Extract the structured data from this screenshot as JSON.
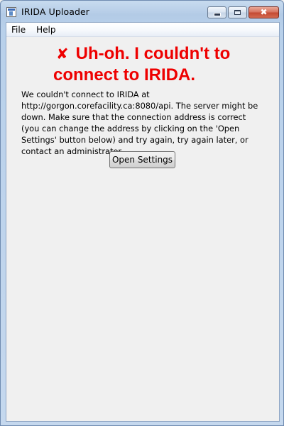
{
  "window": {
    "title": "IRIDA Uploader",
    "icon": "application-icon",
    "controls": {
      "minimize": "minimize-icon",
      "maximize": "maximize-icon",
      "close": "close-icon",
      "close_glyph": "✖"
    }
  },
  "menu": {
    "file": "File",
    "help": "Help"
  },
  "error": {
    "icon": "✘",
    "title": "Uh-oh. I couldn't to connect to IRIDA.",
    "message": "We couldn't connect to IRIDA at http://gorgon.corefacility.ca:8080/api. The server might be down. Make sure that the connection address is correct (you can change the address by clicking on the 'Open Settings' button below) and try again, try again later, or contact an administrator."
  },
  "actions": {
    "open_settings": "Open Settings"
  },
  "colors": {
    "error_red": "#ee0000",
    "background": "#f0f0f0"
  }
}
